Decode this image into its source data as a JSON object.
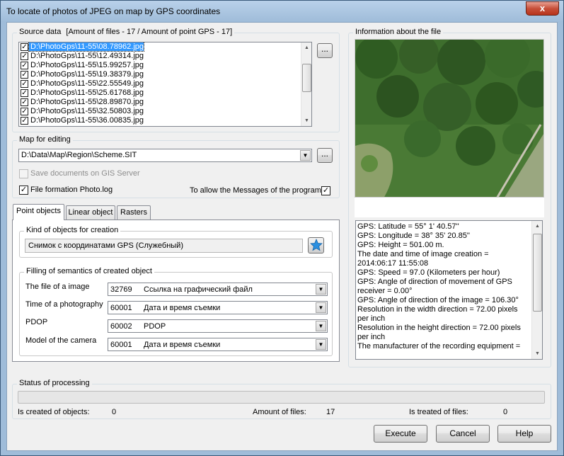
{
  "window": {
    "title": "To locate of photos of JPEG on map by GPS coordinates",
    "close_label": "x"
  },
  "source": {
    "legend": "Source data",
    "summary": "[Amount of files  - 17 / Amount of point GPS - 17]",
    "files": [
      "D:\\PhotoGps\\11-55\\08.78962.jpg",
      "D:\\PhotoGps\\11-55\\12.49314.jpg",
      "D:\\PhotoGps\\11-55\\15.99257.jpg",
      "D:\\PhotoGps\\11-55\\19.38379.jpg",
      "D:\\PhotoGps\\11-55\\22.55549.jpg",
      "D:\\PhotoGps\\11-55\\25.61768.jpg",
      "D:\\PhotoGps\\11-55\\28.89870.jpg",
      "D:\\PhotoGps\\11-55\\32.50803.jpg",
      "D:\\PhotoGps\\11-55\\36.00835.jpg"
    ],
    "browse_label": "...",
    "selected_index": 0
  },
  "map": {
    "legend": "Map for editing",
    "path": "D:\\Data\\Map\\Region\\Scheme.SIT",
    "browse_label": "...",
    "save_gis_label": "Save documents on GIS Server",
    "log_label": "File formation Photo.log",
    "messages_label": "To allow the Messages of the program",
    "check_mark": "✓"
  },
  "tabs": [
    "Point objects",
    "Linear object",
    "Rasters"
  ],
  "kind": {
    "legend": "Kind of objects for creation",
    "value": "Снимок с координатами GPS (Служебный)"
  },
  "semantics": {
    "legend": "Filling of semantics of created object",
    "rows": [
      {
        "label": "The file of a image",
        "code": "32769",
        "text": "Ссылка на графический файл"
      },
      {
        "label": "Time of a photography",
        "code": "60001",
        "text": "Дата и время съемки"
      },
      {
        "label": "PDOP",
        "code": "60002",
        "text": "PDOP"
      },
      {
        "label": "Model of the camera",
        "code": "60001",
        "text": "Дата и время съемки"
      }
    ]
  },
  "info": {
    "legend": "Information about the file",
    "lines": [
      "GPS: Latitude = 55°  1'  40.57''",
      "GPS: Longitude = 38°  35'  20.85''",
      "GPS: Height  = 501.00 m.",
      "The date and time of image creation = 2014:06:17 11:55:08",
      "GPS: Speed = 97.0 (Kilometers per hour)",
      "GPS: Angle of direction of movement of GPS receiver = 0.00°",
      "GPS: Angle of direction of the image = 106.30°",
      "Resolution in the width direction = 72.00 pixels per inch",
      "Resolution in the height direction = 72.00 pixels per inch",
      "The manufacturer of the recording equipment ="
    ]
  },
  "status": {
    "legend": "Status of processing",
    "created_label": "Is created of objects:",
    "created_value": "0",
    "amount_label": "Amount of files:",
    "amount_value": "17",
    "treated_label": "Is treated of files:",
    "treated_value": "0"
  },
  "buttons": {
    "execute": "Execute",
    "cancel": "Cancel",
    "help": "Help"
  },
  "icons": {
    "dropdown": "chevron-down-icon",
    "star": "star-icon"
  },
  "colors": {
    "selection": "#3399ff",
    "star": "#2a8fe0"
  }
}
